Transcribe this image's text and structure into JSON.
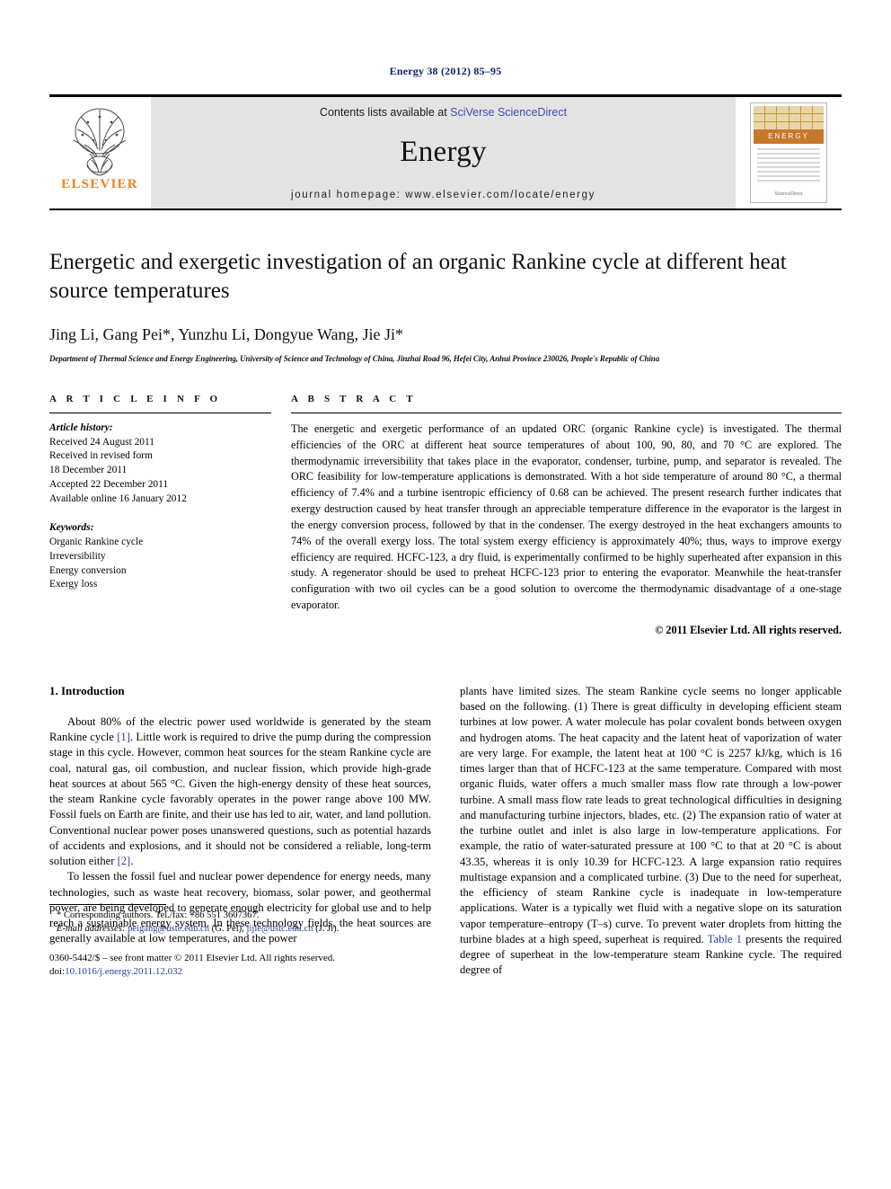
{
  "running_head": "Energy 38 (2012) 85–95",
  "masthead": {
    "publisher_name": "ELSEVIER",
    "contents_prefix": "Contents lists available at ",
    "contents_link": "SciVerse ScienceDirect",
    "journal_name": "Energy",
    "homepage": "journal homepage: www.elsevier.com/locate/energy",
    "cover_title": "ENERGY",
    "cover_footer": "ScienceDirect"
  },
  "article": {
    "title": "Energetic and exergetic investigation of an organic Rankine cycle at different heat source temperatures",
    "authors": "Jing Li, Gang Pei*, Yunzhu Li, Dongyue Wang, Jie Ji*",
    "affiliation": "Department of Thermal Science and Energy Engineering, University of Science and Technology of China, Jinzhai Road 96, Hefei City, Anhui Province 230026, People's Republic of China"
  },
  "article_info": {
    "heading": "A R T I C L E   I N F O",
    "history_label": "Article history:",
    "history": [
      "Received 24 August 2011",
      "Received in revised form",
      "18 December 2011",
      "Accepted 22 December 2011",
      "Available online 16 January 2012"
    ],
    "keywords_label": "Keywords:",
    "keywords": [
      "Organic Rankine cycle",
      "Irreversibility",
      "Energy conversion",
      "Exergy loss"
    ]
  },
  "abstract": {
    "heading": "A B S T R A C T",
    "text": "The energetic and exergetic performance of an updated ORC (organic Rankine cycle) is investigated. The thermal efficiencies of the ORC at different heat source temperatures of about 100, 90, 80, and 70 °C are explored. The thermodynamic irreversibility that takes place in the evaporator, condenser, turbine, pump, and separator is revealed. The ORC feasibility for low-temperature applications is demonstrated. With a hot side temperature of around 80 °C, a thermal efficiency of 7.4% and a turbine isentropic efficiency of 0.68 can be achieved. The present research further indicates that exergy destruction caused by heat transfer through an appreciable temperature difference in the evaporator is the largest in the energy conversion process, followed by that in the condenser. The exergy destroyed in the heat exchangers amounts to 74% of the overall exergy loss. The total system exergy efficiency is approximately 40%; thus, ways to improve exergy efficiency are required. HCFC-123, a dry fluid, is experimentally confirmed to be highly superheated after expansion in this study. A regenerator should be used to preheat HCFC-123 prior to entering the evaporator. Meanwhile the heat-transfer configuration with two oil cycles can be a good solution to overcome the thermodynamic disadvantage of a one-stage evaporator.",
    "copyright": "© 2011 Elsevier Ltd. All rights reserved."
  },
  "introduction": {
    "heading": "1.  Introduction",
    "left_paragraphs": [
      {
        "part1": "About 80% of the electric power used worldwide is generated by the steam Rankine cycle ",
        "ref": "[1]",
        "part2": ". Little work is required to drive the pump during the compression stage in this cycle. However, common heat sources for the steam Rankine cycle are coal, natural gas, oil combustion, and nuclear fission, which provide high-grade heat sources at about 565 °C. Given the high-energy density of these heat sources, the steam Rankine cycle favorably operates in the power range above 100 MW. Fossil fuels on Earth are finite, and their use has led to air, water, and land pollution. Conventional nuclear power poses unanswered questions, such as potential hazards of accidents and explosions, and it should not be considered a reliable, long-term solution either ",
        "ref2": "[2]",
        "part3": "."
      },
      {
        "text": "To lessen the fossil fuel and nuclear power dependence for energy needs, many technologies, such as waste heat recovery, biomass, solar power, and geothermal power, are being developed to generate enough electricity for global use and to help reach a sustainable energy system. In these technology fields, the heat sources are generally available at low temperatures, and the power"
      }
    ],
    "right_text_part1": "plants have limited sizes. The steam Rankine cycle seems no longer applicable based on the following. (1) There is great difficulty in developing efficient steam turbines at low power. A water molecule has polar covalent bonds between oxygen and hydrogen atoms. The heat capacity and the latent heat of vaporization of water are very large. For example, the latent heat at 100 °C is 2257 kJ/kg, which is 16 times larger than that of HCFC-123 at the same temperature. Compared with most organic fluids, water offers a much smaller mass flow rate through a low-power turbine. A small mass flow rate leads to great technological difficulties in designing and manufacturing turbine injectors, blades, etc. (2) The expansion ratio of water at the turbine outlet and inlet is also large in low-temperature applications. For example, the ratio of water-saturated pressure at 100 °C to that at 20 °C is about 43.35, whereas it is only 10.39 for HCFC-123. A large expansion ratio requires multistage expansion and a complicated turbine. (3) Due to the need for superheat, the efficiency of steam Rankine cycle is inadequate in low-temperature applications. Water is a typically wet fluid with a negative slope on its saturation vapor temperature–entropy (T–s) curve. To prevent water droplets from hitting the turbine blades at a high speed, superheat is required. ",
    "right_table_ref": "Table 1",
    "right_text_part2": " presents the required degree of superheat in the low-temperature steam Rankine cycle. The required degree of"
  },
  "footnotes": {
    "corresponding": "* Corresponding authors. Tel./fax: +86 551 3607367.",
    "email_label": "E-mail addresses:",
    "email1": "peigang@ustc.edu.cn",
    "email1_owner": "(G. Pei),",
    "email2": "jijie@ustc.edu.cn",
    "email2_owner": "(J. Ji).",
    "issn_line": "0360-5442/$ – see front matter © 2011 Elsevier Ltd. All rights reserved.",
    "doi_label": "doi:",
    "doi_value": "10.1016/j.energy.2011.12.032"
  },
  "colors": {
    "running_head": "#14206e",
    "link": "#2a3fa0",
    "sciverse_link": "#3b4fb5",
    "elsevier_orange": "#f07f1a",
    "masthead_bg": "#e3e3e3"
  }
}
